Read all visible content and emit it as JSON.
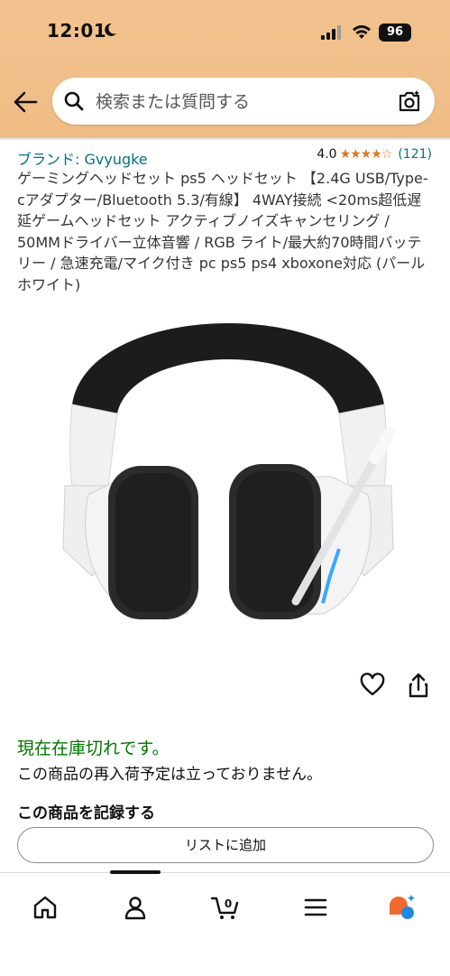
{
  "status_bar": {
    "time": "12:01",
    "battery": "96"
  },
  "search": {
    "placeholder": "検索または質問する"
  },
  "product": {
    "brand": "ブランド: Gvyugke",
    "rating": "4.0",
    "stars": "★★★★☆",
    "review_count": "(121)",
    "title": "ゲーミングヘッドセット ps5 ヘッドセット 【2.4G USB/Type-cアダプター/Bluetooth 5.3/有線】 4WAY接続 <20ms超低遅延ゲームヘッドセット アクティブノイズキャンセリング / 50MMドライバー立体音響 / RGB ライト/最大約70時間バッテリー / 急速充電/マイク付き pc ps5 ps4 xboxone対応 (パールホワイト)"
  },
  "availability": {
    "status": "現在在庫切れです。",
    "restock": "この商品の再入荷予定は立っておりません。"
  },
  "record": {
    "heading": "この商品を記録する",
    "add_to_list": "リストに追加"
  },
  "tabs": [
    {
      "icon": "home-icon"
    },
    {
      "icon": "account-icon"
    },
    {
      "icon": "cart-icon",
      "badge": "0"
    },
    {
      "icon": "menu-icon"
    },
    {
      "icon": "rufus-icon"
    }
  ],
  "colors": {
    "header": "#f0bf89",
    "link": "#007185",
    "in_stock_green": "#007600",
    "star": "#de7921"
  }
}
